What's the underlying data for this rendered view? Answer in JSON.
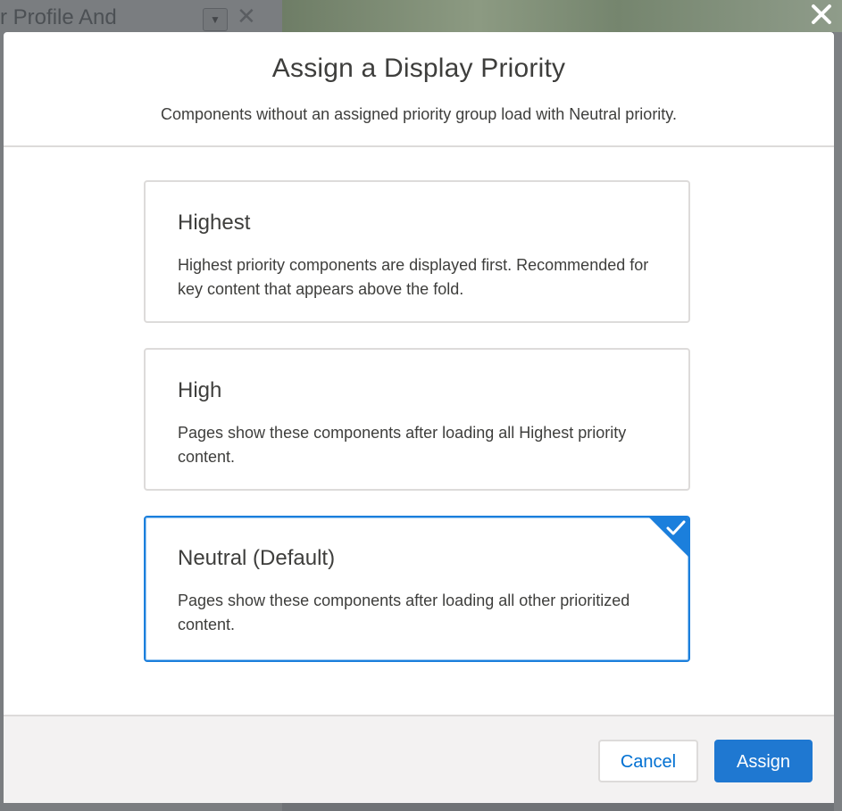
{
  "background": {
    "title_prefix": "r",
    "title": "Profile And",
    "dropdown_icon": "chevron-down-icon",
    "close_icon": "close-icon"
  },
  "modal": {
    "close_icon": "close-icon",
    "title": "Assign a Display Priority",
    "subtitle": "Components without an assigned priority group load with Neutral priority.",
    "options": [
      {
        "title": "Highest",
        "description": "Highest priority components are displayed first. Recommended for key content that appears above the fold.",
        "selected": false
      },
      {
        "title": "High",
        "description": "Pages show these components after loading all Highest priority content.",
        "selected": false
      },
      {
        "title": "Neutral (Default)",
        "description": "Pages show these components after loading all other prioritized content.",
        "selected": true
      }
    ],
    "footer": {
      "cancel_label": "Cancel",
      "assign_label": "Assign"
    }
  },
  "colors": {
    "accent": "#1b7fdc",
    "brand_button": "#1f78d1",
    "link": "#0070d2"
  }
}
